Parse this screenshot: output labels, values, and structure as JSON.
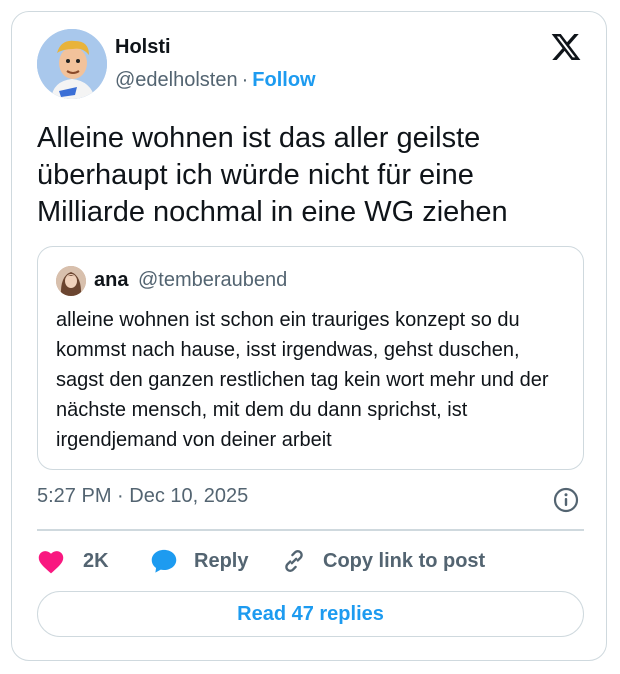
{
  "author": {
    "name": "Holsti",
    "handle": "@edelholsten",
    "separator": "·",
    "follow_label": "Follow"
  },
  "tweet": {
    "text": "Alleine wohnen ist das aller geilste überhaupt ich würde nicht für eine Milliarde nochmal in eine WG ziehen",
    "time": "5:27 PM",
    "separator": "·",
    "date": "Dec 10, 2025"
  },
  "quote": {
    "name": "ana",
    "handle": "@temberaubend",
    "text": "alleine wohnen ist schon ein trauriges konzept so du kommst nach hause, isst irgendwas, gehst duschen, sagst den ganzen restlichen tag kein wort mehr und der nächste mensch, mit dem du dann sprichst, ist irgendjemand von deiner arbeit"
  },
  "actions": {
    "like_count": "2K",
    "reply_label": "Reply",
    "copy_label": "Copy link to post"
  },
  "read_replies_label": "Read 47 replies",
  "icons": [
    "x-logo-icon",
    "info-icon",
    "heart-icon",
    "reply-bubble-icon",
    "link-icon"
  ],
  "colors": {
    "accent": "#1d9bf0",
    "heart": "#f91880",
    "text": "#0f1419",
    "secondary": "#536471",
    "border": "#cfd9de"
  }
}
